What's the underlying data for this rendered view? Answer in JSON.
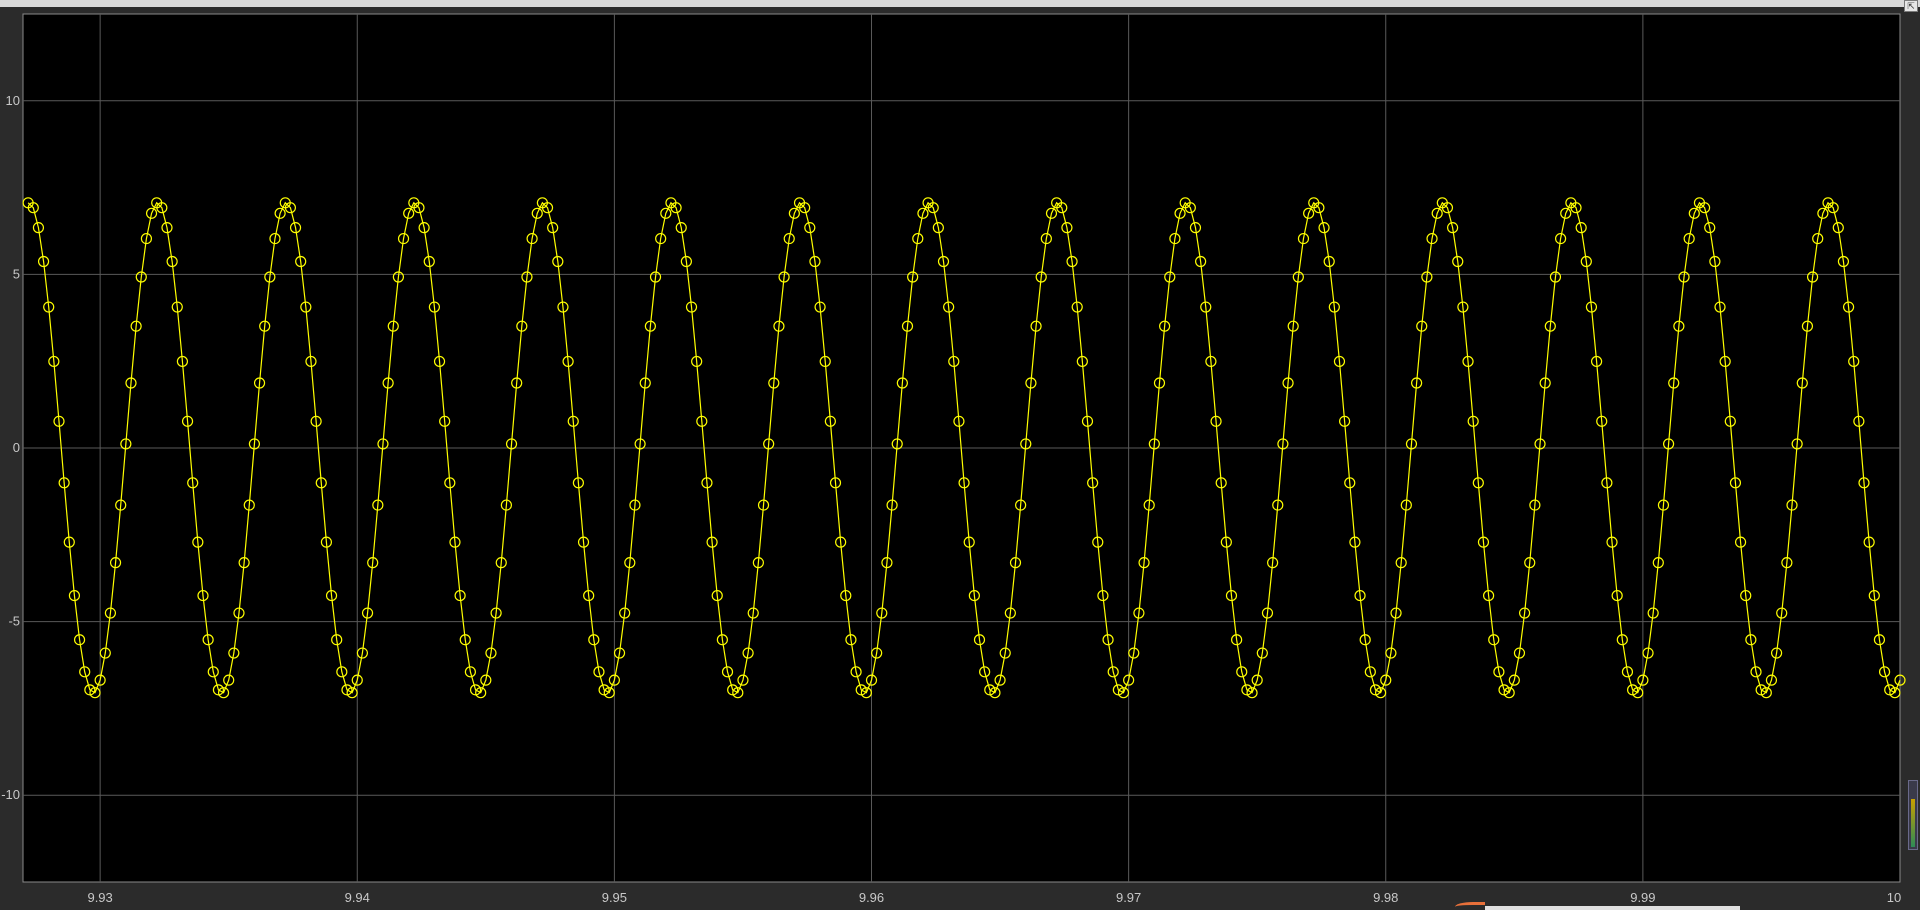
{
  "window": {
    "corner_button_glyph": "⇱"
  },
  "colors": {
    "background": "#000000",
    "frame": "#2b2b2b",
    "grid": "#5a5a5a",
    "signal": "#ffff00",
    "tick_text": "#c8c8c8"
  },
  "chart_data": {
    "type": "line",
    "title": "",
    "xlabel": "",
    "ylabel": "",
    "xlim": [
      9.927,
      10.0
    ],
    "ylim": [
      -12.5,
      12.5
    ],
    "grid": true,
    "legend": "none",
    "marker": "circle",
    "x_ticks": [
      9.93,
      9.94,
      9.95,
      9.96,
      9.97,
      9.98,
      9.99,
      10.0
    ],
    "x_tick_labels": [
      "9.93",
      "9.94",
      "9.95",
      "9.96",
      "9.97",
      "9.98",
      "9.99",
      "10"
    ],
    "y_ticks": [
      10,
      5,
      0,
      -5,
      -10
    ],
    "y_tick_labels": [
      "10",
      "5",
      "0",
      "-5",
      "-10"
    ],
    "series": [
      {
        "amplitude": 7.07,
        "frequency_hz": 200,
        "sample_time": 0.0002,
        "x_start": 9.9272,
        "x_end": 10.0,
        "phase_rad": -1.24
      }
    ]
  }
}
